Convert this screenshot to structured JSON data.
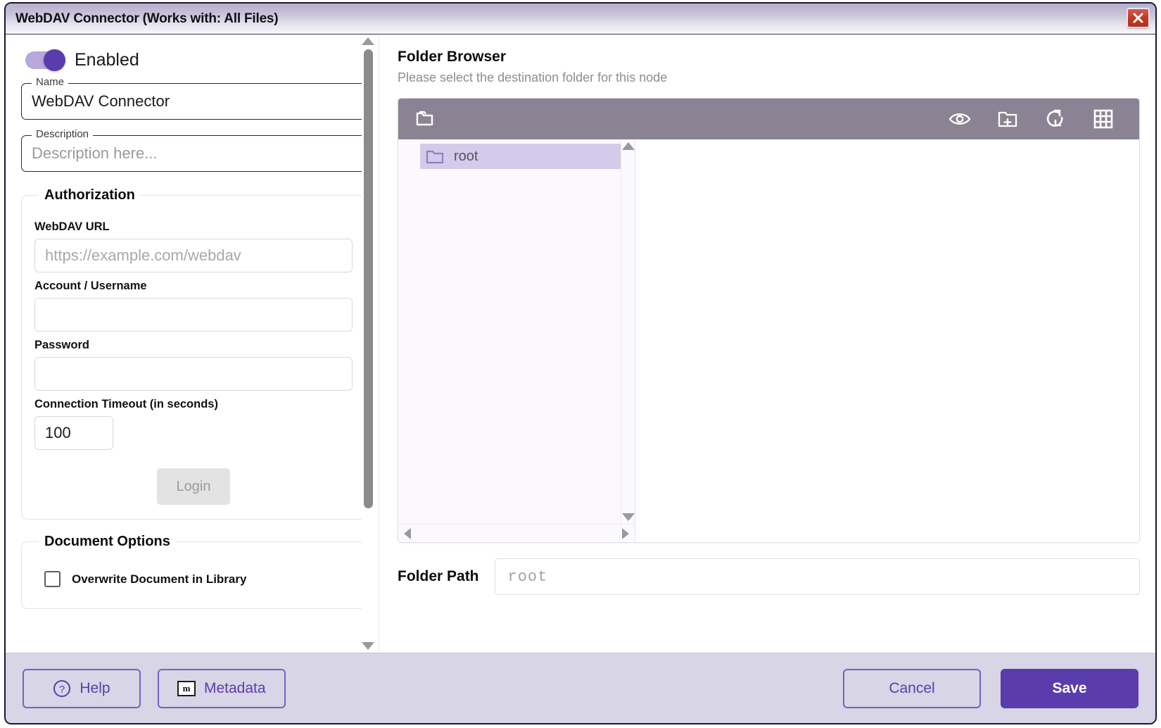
{
  "window": {
    "title": "WebDAV Connector (Works with: All Files)",
    "close_label": "×",
    "accent_color": "#5b3cac",
    "toolbar_color": "#8b8394",
    "footer_color": "#d7d5e6"
  },
  "left_panel": {
    "enabled_toggle": {
      "label": "Enabled",
      "state": "on"
    },
    "name_field": {
      "label": "Name",
      "value": "WebDAV Connector"
    },
    "description_field": {
      "label": "Description",
      "value": "",
      "placeholder": "Description here..."
    },
    "authorization": {
      "legend": "Authorization",
      "url_field": {
        "label": "WebDAV URL",
        "value": "",
        "placeholder": "https://example.com/webdav"
      },
      "username_field": {
        "label": "Account / Username",
        "value": "",
        "placeholder": ""
      },
      "password_field": {
        "label": "Password",
        "value": "",
        "placeholder": ""
      },
      "timeout_field": {
        "label": "Connection Timeout (in seconds)",
        "value": "100"
      },
      "login_button": {
        "label": "Login",
        "state": "disabled"
      }
    },
    "document_options": {
      "legend": "Document Options",
      "overwrite_checkbox": {
        "label": "Overwrite Document in Library",
        "checked": false
      }
    }
  },
  "folder_browser": {
    "title": "Folder Browser",
    "subtitle": "Please select the destination folder for this node",
    "toolbar": {
      "left_icon": "folder-copy-icon",
      "actions": [
        {
          "name": "preview-icon",
          "tooltip": "Preview"
        },
        {
          "name": "new-folder-icon",
          "tooltip": "New Folder"
        },
        {
          "name": "refresh-icon",
          "tooltip": "Refresh"
        },
        {
          "name": "grid-view-icon",
          "tooltip": "Grid View"
        }
      ]
    },
    "tree": {
      "items": [
        {
          "label": "root",
          "selected": true,
          "icon": "folder-icon"
        }
      ]
    },
    "folder_path": {
      "label": "Folder Path",
      "value": "",
      "placeholder": "root"
    }
  },
  "footer": {
    "help_button": "Help",
    "metadata_button": "Metadata",
    "metadata_icon_glyph": "m",
    "cancel_button": "Cancel",
    "save_button": "Save"
  }
}
